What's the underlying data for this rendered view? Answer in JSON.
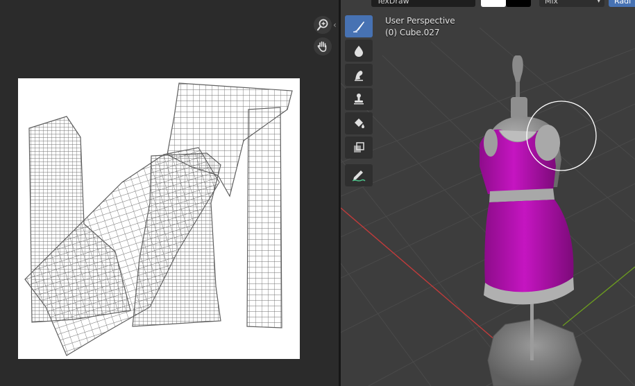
{
  "uv_editor": {
    "zoom_icon": "zoom-in-icon",
    "pan_icon": "hand-icon",
    "collapse_icon": "chevron-left-icon"
  },
  "header": {
    "brush_name": "TexDraw",
    "blend_mode": "Mix",
    "radius_label": "Radi",
    "colors": {
      "primary": "#ffffff",
      "secondary": "#000000"
    }
  },
  "viewport": {
    "view_name": "User Perspective",
    "object_name": "(0) Cube.027"
  },
  "tools": [
    {
      "name": "draw-tool",
      "icon": "brush-icon",
      "active": true
    },
    {
      "name": "soften-tool",
      "icon": "drop-icon",
      "active": false
    },
    {
      "name": "smear-tool",
      "icon": "smear-icon",
      "active": false
    },
    {
      "name": "clone-tool",
      "icon": "stamp-icon",
      "active": false
    },
    {
      "name": "fill-tool",
      "icon": "bucket-icon",
      "active": false
    },
    {
      "name": "mask-tool",
      "icon": "mask-icon",
      "active": false
    },
    {
      "name": "annotate-tool",
      "icon": "pencil-icon",
      "active": false
    }
  ],
  "colors": {
    "accent": "#4772b3",
    "dress": "#b30fb0",
    "viewport_bg": "#3d3d3d",
    "grid_x_axis": "#c23b3b",
    "grid_y_axis": "#6b9a20"
  }
}
